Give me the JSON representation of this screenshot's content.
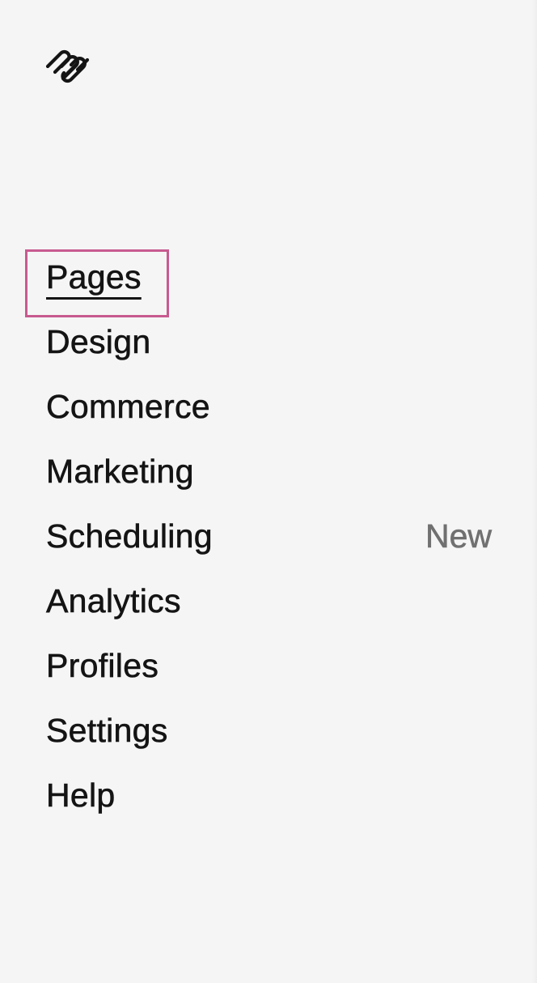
{
  "logo": {
    "icon": "squarespace-logo-icon"
  },
  "nav": {
    "items": [
      {
        "label": "Pages",
        "active": true
      },
      {
        "label": "Design"
      },
      {
        "label": "Commerce"
      },
      {
        "label": "Marketing"
      },
      {
        "label": "Scheduling",
        "badge": "New"
      },
      {
        "label": "Analytics"
      },
      {
        "label": "Profiles"
      },
      {
        "label": "Settings"
      },
      {
        "label": "Help"
      }
    ]
  },
  "colors": {
    "background": "#f5f5f5",
    "text": "#141414",
    "badge": "#707070",
    "highlight": "#c85a8f"
  }
}
